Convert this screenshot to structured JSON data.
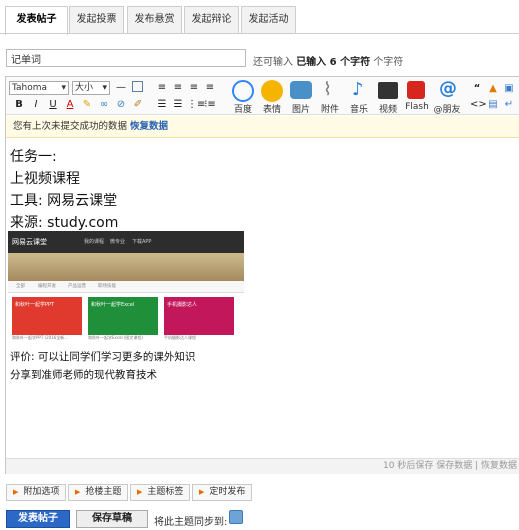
{
  "tabs": [
    {
      "label": "发表帖子",
      "active": true
    },
    {
      "label": "发起投票",
      "active": false
    },
    {
      "label": "发布悬赏",
      "active": false
    },
    {
      "label": "发起辩论",
      "active": false
    },
    {
      "label": "发起活动",
      "active": false
    }
  ],
  "subject": {
    "value": "记单词",
    "counter_prefix": "还可输入",
    "counter_strong": "已输入 6 个字符",
    "counter_suffix": "个字符"
  },
  "toolbar": {
    "font_family": "Tahoma",
    "font_size": "大小",
    "media": [
      {
        "label": "百度",
        "icon": "baidu-icon",
        "color": "#3385ff"
      },
      {
        "label": "表情",
        "icon": "smiley-icon",
        "color": "#f5b400"
      },
      {
        "label": "图片",
        "icon": "image-icon",
        "color": "#4a90c8"
      },
      {
        "label": "附件",
        "icon": "paperclip-icon",
        "color": "#777777"
      },
      {
        "label": "音乐",
        "icon": "music-icon",
        "color": "#2a7fd4"
      },
      {
        "label": "视频",
        "icon": "video-icon",
        "color": "#333333"
      },
      {
        "label": "Flash",
        "icon": "flash-icon",
        "color": "#d7261e"
      },
      {
        "label": "@朋友",
        "icon": "at-icon",
        "color": "#2a7fd4"
      }
    ]
  },
  "notice": {
    "text": "您有上次未提交成功的数据",
    "link": "恢复数据"
  },
  "content": {
    "lines": [
      "任务一:",
      "上视频课程",
      "工具: 网易云课堂",
      "来源: study.com"
    ],
    "embedded_logo": "网易云课堂",
    "embedded_nav": [
      "我的课程",
      "微专业",
      "下载APP"
    ],
    "embedded_tabs": [
      "全部",
      "编程开发",
      "产品运营",
      "职场技能"
    ],
    "cards": [
      {
        "title": "和秋叶一起学PPT",
        "caption": "和秋叶一起学PPT (2016全新..."
      },
      {
        "title": "和秋叶一起学Excel",
        "caption": "和秋叶一起学Excel (图文课程)"
      },
      {
        "title": "手机摄影达人",
        "caption": "手机摄影达人课程"
      }
    ],
    "after_lines": [
      "评价: 可以让同学们学习更多的课外知识",
      "分享到准师老师的现代教育技术"
    ]
  },
  "status": {
    "autosave": "10 秒后保存",
    "save": "保存数据",
    "restore": "恢复数据"
  },
  "options": [
    "附加选项",
    "抢楼主题",
    "主题标签",
    "定时发布"
  ],
  "actions": {
    "post": "发表帖子",
    "draft": "保存草稿",
    "sync_label": "将此主题同步到:"
  }
}
